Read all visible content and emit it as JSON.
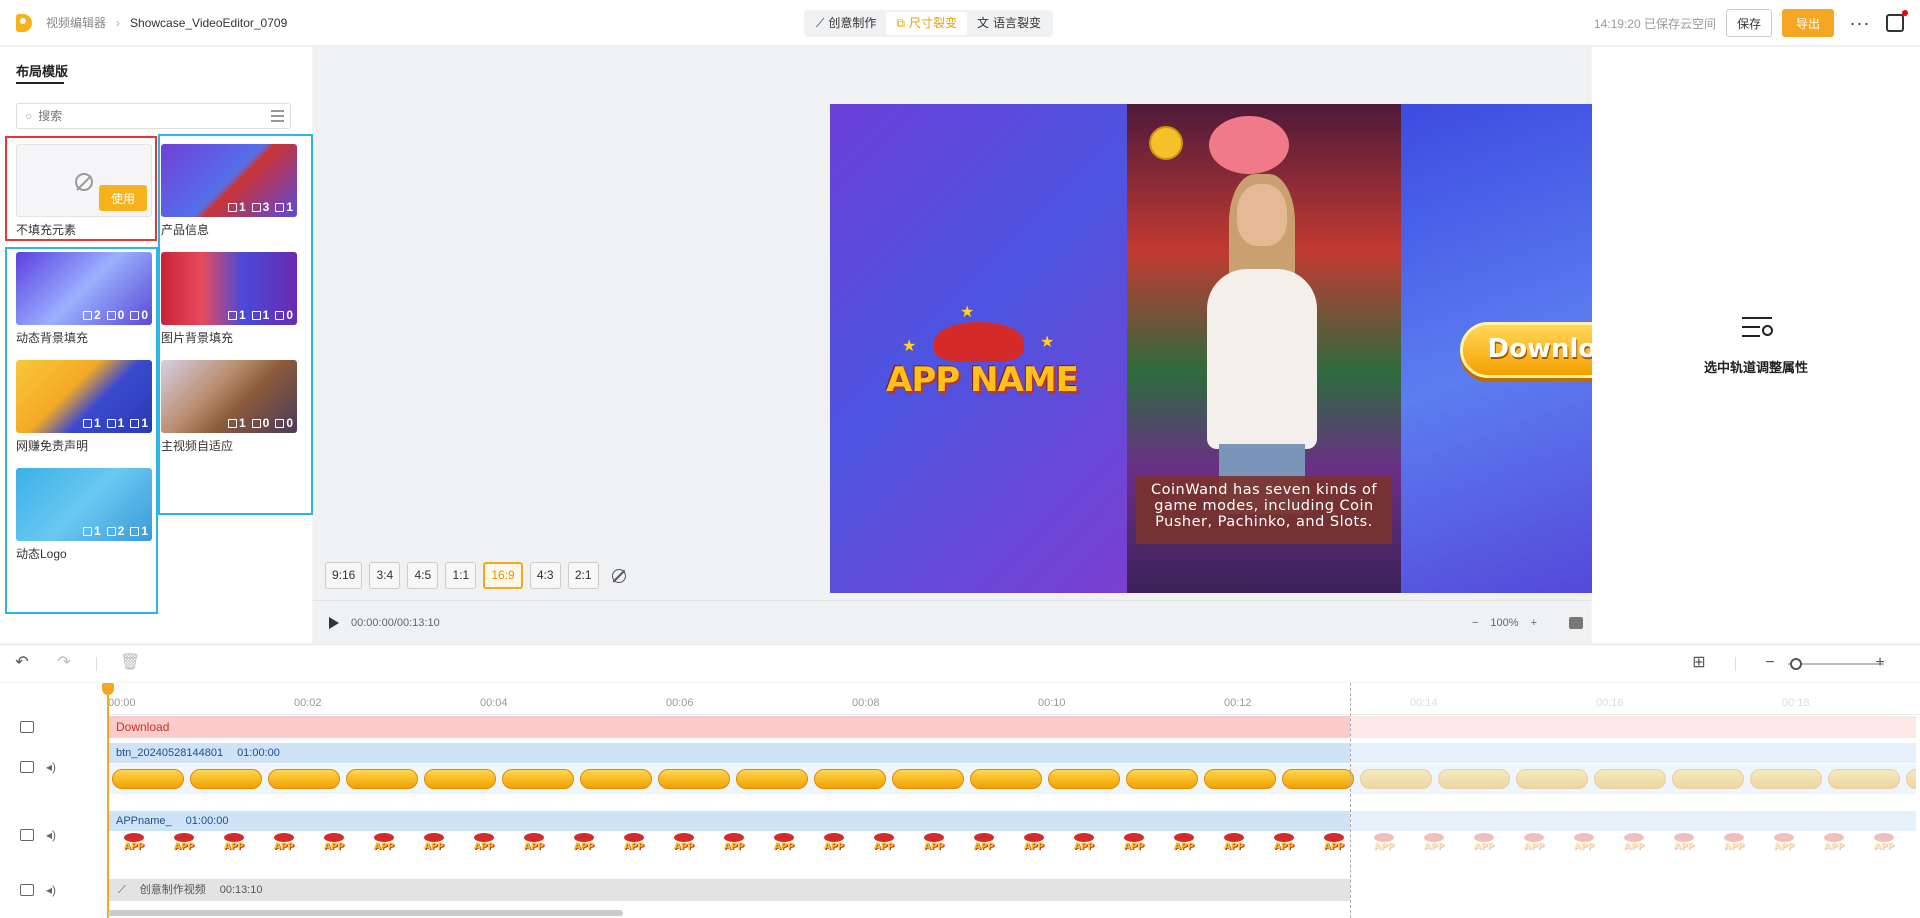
{
  "topbar": {
    "breadcrumb_root": "视频编辑器",
    "project_name": "Showcase_VideoEditor_0709",
    "tabs": [
      {
        "label": "创意制作",
        "active": false
      },
      {
        "label": "尺寸裂变",
        "active": true
      },
      {
        "label": "语言裂变",
        "active": false
      }
    ],
    "save_status": "14:19:20 已保存云空间",
    "save_label": "保存",
    "export_label": "导出",
    "more_label": "···"
  },
  "left_panel": {
    "title": "布局模版",
    "search_placeholder": "搜索",
    "templates": [
      {
        "label": "不填充元素",
        "use_label": "使用"
      },
      {
        "label": "产品信息",
        "counts": [
          "1",
          "3",
          "1"
        ]
      },
      {
        "label": "动态背景填充",
        "counts": [
          "2",
          "0",
          "0"
        ]
      },
      {
        "label": "图片背景填充",
        "counts": [
          "1",
          "1",
          "0"
        ]
      },
      {
        "label": "网赚免责声明",
        "counts": [
          "1",
          "1",
          "1"
        ]
      },
      {
        "label": "主视频自适应",
        "counts": [
          "1",
          "0",
          "0"
        ]
      },
      {
        "label": "动态Logo",
        "counts": [
          "1",
          "2",
          "1"
        ]
      }
    ]
  },
  "preview": {
    "app_name": "APP NAME",
    "download_label": "Download",
    "caption": "CoinWand has seven kinds of game modes, including Coin Pusher, Pachinko, and Slots."
  },
  "ratios": [
    {
      "label": "9:16",
      "active": false
    },
    {
      "label": "3:4",
      "active": false
    },
    {
      "label": "4:5",
      "active": false
    },
    {
      "label": "1:1",
      "active": false
    },
    {
      "label": "16:9",
      "active": true
    },
    {
      "label": "4:3",
      "active": false
    },
    {
      "label": "2:1",
      "active": false
    }
  ],
  "player": {
    "time": "00:00:00/00:13:10",
    "zoom": "100%"
  },
  "right_panel": {
    "hint": "选中轨道调整属性"
  },
  "timeline": {
    "ticks": [
      "00:00",
      "00:02",
      "00:04",
      "00:06",
      "00:08",
      "00:10",
      "00:12",
      "00:14",
      "00:16",
      "00:18"
    ],
    "text_clip": "Download",
    "btn_clip_name": "btn_20240528144801",
    "btn_clip_duration": "01:00:00",
    "app_clip_name": "APPname_",
    "app_clip_duration": "01:00:00",
    "main_clip_name": "创意制作视频",
    "main_clip_duration": "00:13:10"
  },
  "colors": {
    "accent": "#f5a623",
    "highlight_red": "#e33333",
    "highlight_blue": "#2bb6e8"
  }
}
